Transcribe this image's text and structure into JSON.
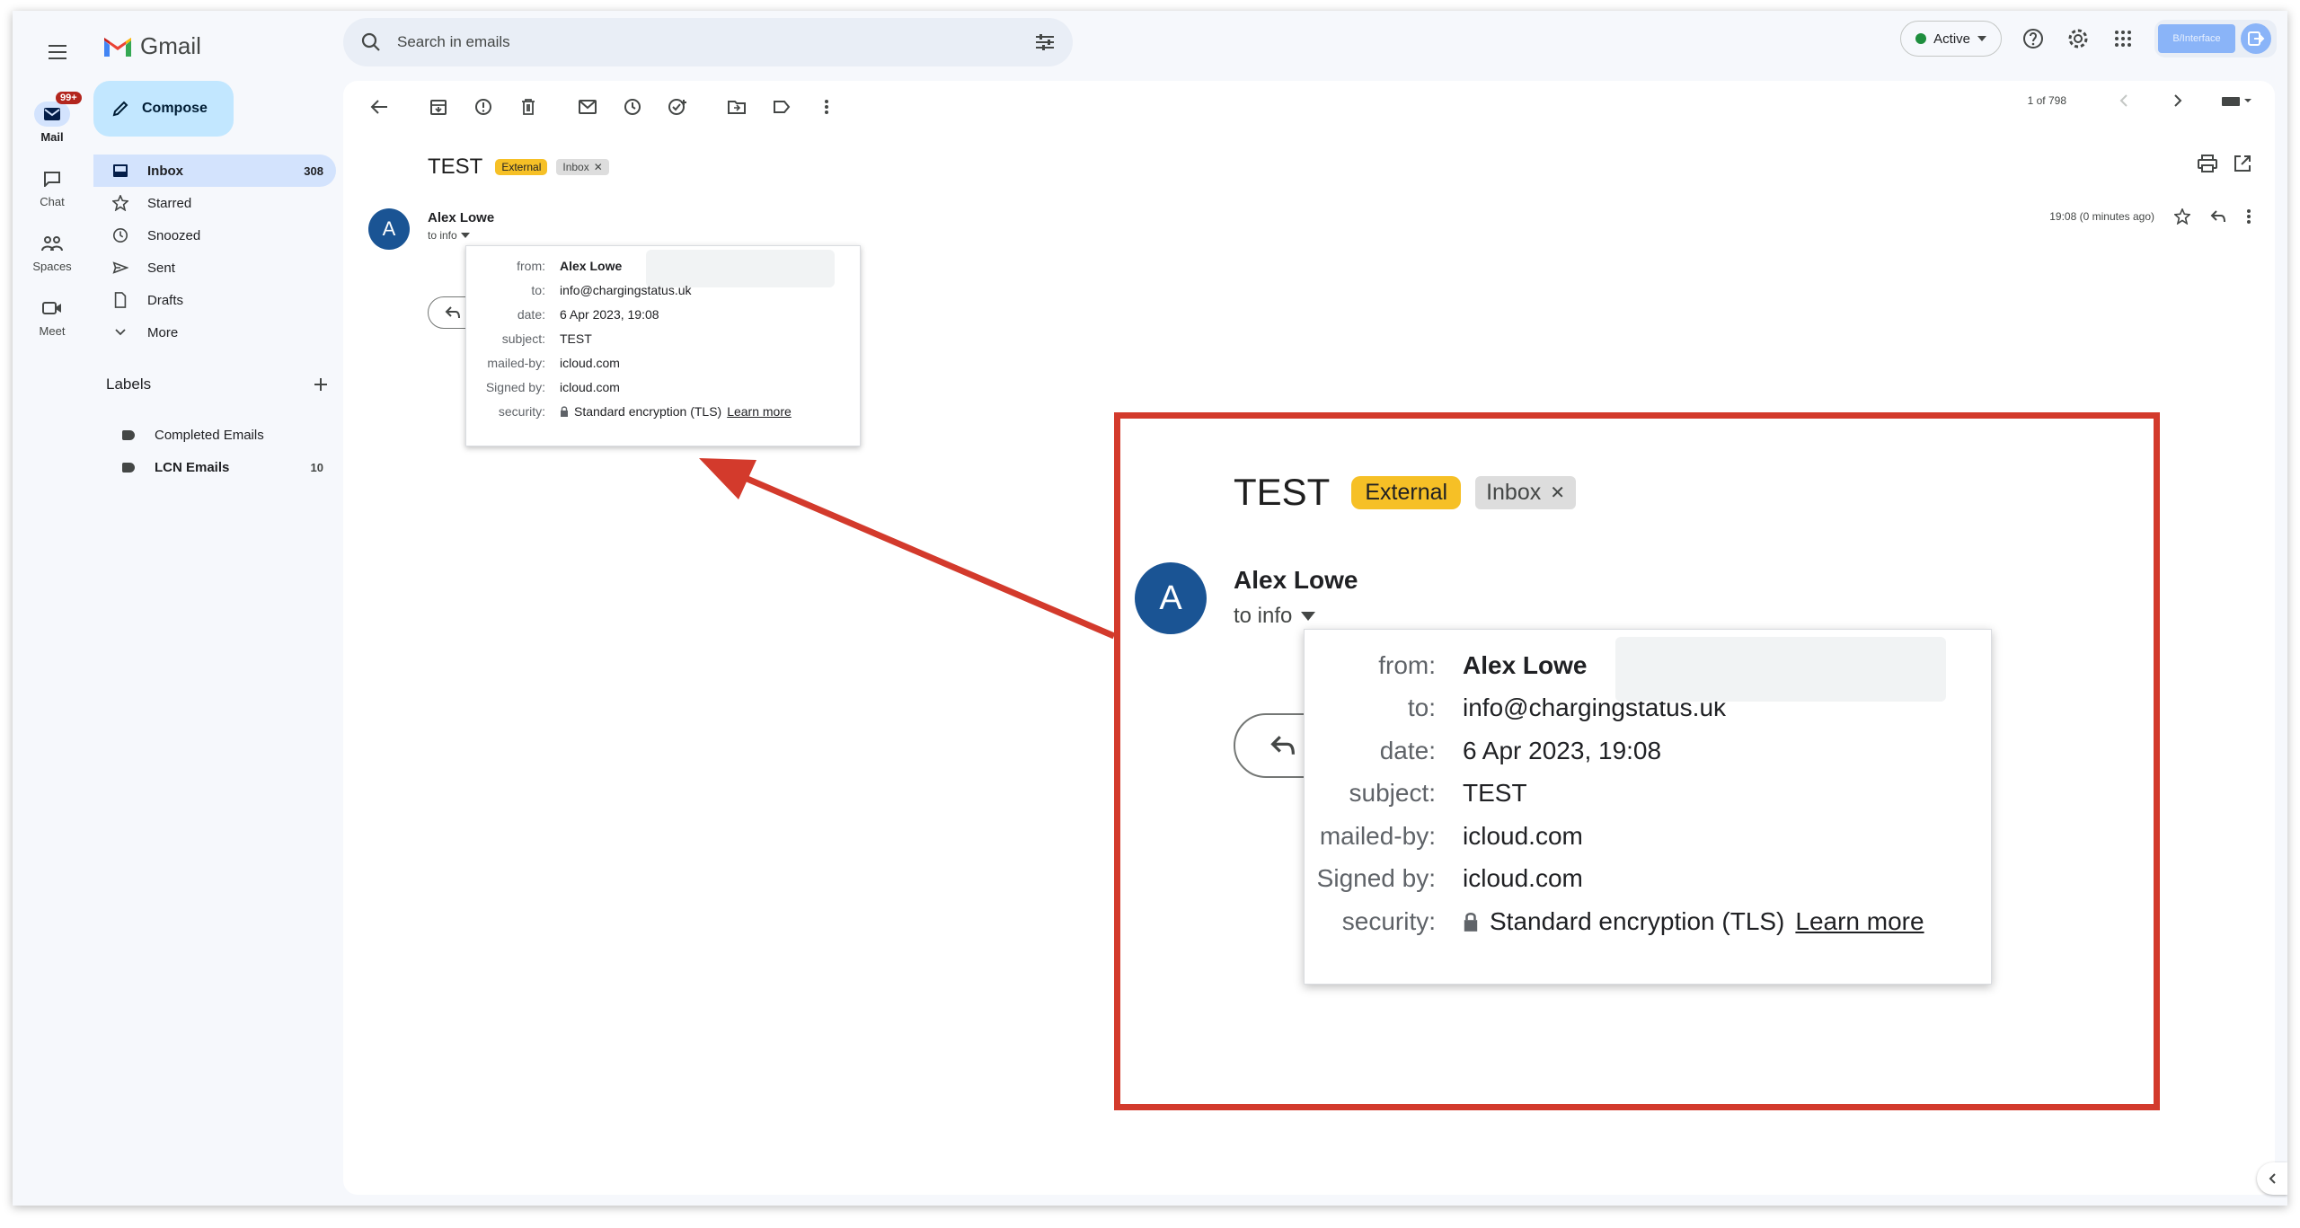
{
  "app": {
    "name": "Gmail"
  },
  "rail": [
    {
      "label": "Mail",
      "badge": "99+",
      "active": true
    },
    {
      "label": "Chat"
    },
    {
      "label": "Spaces"
    },
    {
      "label": "Meet"
    }
  ],
  "compose": {
    "label": "Compose"
  },
  "nav": [
    {
      "label": "Inbox",
      "count": "308",
      "icon": "inbox-icon"
    },
    {
      "label": "Starred",
      "count": "",
      "icon": "star-icon"
    },
    {
      "label": "Snoozed",
      "count": "",
      "icon": "clock-icon"
    },
    {
      "label": "Sent",
      "count": "",
      "icon": "send-icon"
    },
    {
      "label": "Drafts",
      "count": "",
      "icon": "draft-icon"
    },
    {
      "label": "More",
      "count": "",
      "icon": "chevron-down-icon"
    }
  ],
  "labels": {
    "title": "Labels",
    "items": [
      {
        "label": "Completed Emails",
        "count": ""
      },
      {
        "label": "LCN Emails",
        "count": "10"
      }
    ]
  },
  "search": {
    "placeholder": "Search in emails"
  },
  "status": {
    "label": "Active",
    "color": "#1e8e3e"
  },
  "account": {
    "brand": "B/Interface"
  },
  "pager": {
    "text": "1 of 798"
  },
  "email": {
    "subject": "TEST",
    "chips": {
      "external": "External",
      "inbox": "Inbox"
    },
    "avatar_letter": "A",
    "sender": "Alex Lowe",
    "to_line": "to info",
    "time": "19:08 (0 minutes ago)",
    "details": {
      "from_label": "from:",
      "from": "Alex Lowe",
      "to_label": "to:",
      "to": "info@chargingstatus.uk",
      "date_label": "date:",
      "date": "6 Apr 2023, 19:08",
      "subject_label": "subject:",
      "subject": "TEST",
      "mailedby_label": "mailed-by:",
      "mailedby": "icloud.com",
      "signedby_label": "Signed by:",
      "signedby": "icloud.com",
      "security_label": "security:",
      "security": "Standard encryption (TLS)",
      "learn_more": "Learn more"
    }
  },
  "colors": {
    "accent": "#d33a2c",
    "external_chip": "#f6c026",
    "avatar": "#1a5494",
    "selected": "#d3e3fd"
  }
}
